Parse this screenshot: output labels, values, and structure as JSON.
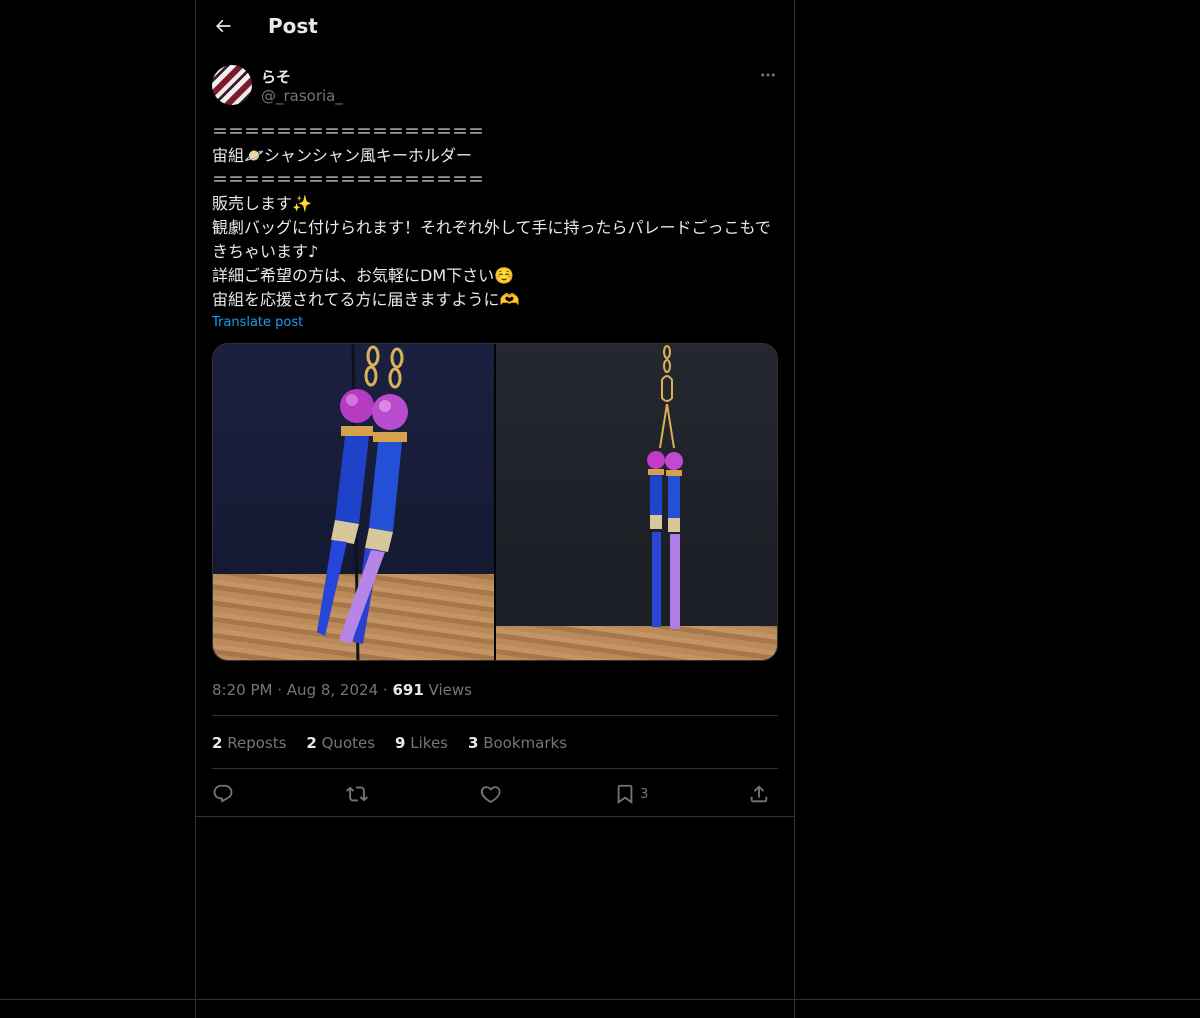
{
  "header": {
    "title": "Post",
    "back_icon": "arrow-left-icon"
  },
  "author": {
    "name": "らそ",
    "handle": "@_rasoria_"
  },
  "post": {
    "lines": [
      "＝＝＝＝＝＝＝＝＝＝＝＝＝＝＝＝＝",
      "宙組🪐シャンシャン風キーホルダー",
      "＝＝＝＝＝＝＝＝＝＝＝＝＝＝＝＝＝",
      "販売します✨",
      "観劇バッグに付けられます！それぞれ外して手に持ったらパレードごっこもできちゃいます♪",
      "詳細ご希望の方は、お気軽にDM下さい☺️",
      "宙組を応援されてる方に届きますように🫶"
    ],
    "translate": "Translate post"
  },
  "meta": {
    "time": "8:20 PM",
    "date": "Aug 8, 2024",
    "views_count": "691",
    "views_label": "Views",
    "dot": "·"
  },
  "stats": [
    {
      "count": "2",
      "label": "Reposts"
    },
    {
      "count": "2",
      "label": "Quotes"
    },
    {
      "count": "9",
      "label": "Likes"
    },
    {
      "count": "3",
      "label": "Bookmarks"
    }
  ],
  "actions": {
    "reply": {
      "icon": "reply-icon"
    },
    "repost": {
      "icon": "repost-icon"
    },
    "like": {
      "icon": "heart-icon"
    },
    "bookmark": {
      "icon": "bookmark-icon",
      "count": "3"
    },
    "share": {
      "icon": "share-icon"
    }
  },
  "colors": {
    "accent": "#1d9bf0",
    "text": "#e7e9ea",
    "muted": "#71767b",
    "border": "#2f3336",
    "background": "#000000"
  }
}
